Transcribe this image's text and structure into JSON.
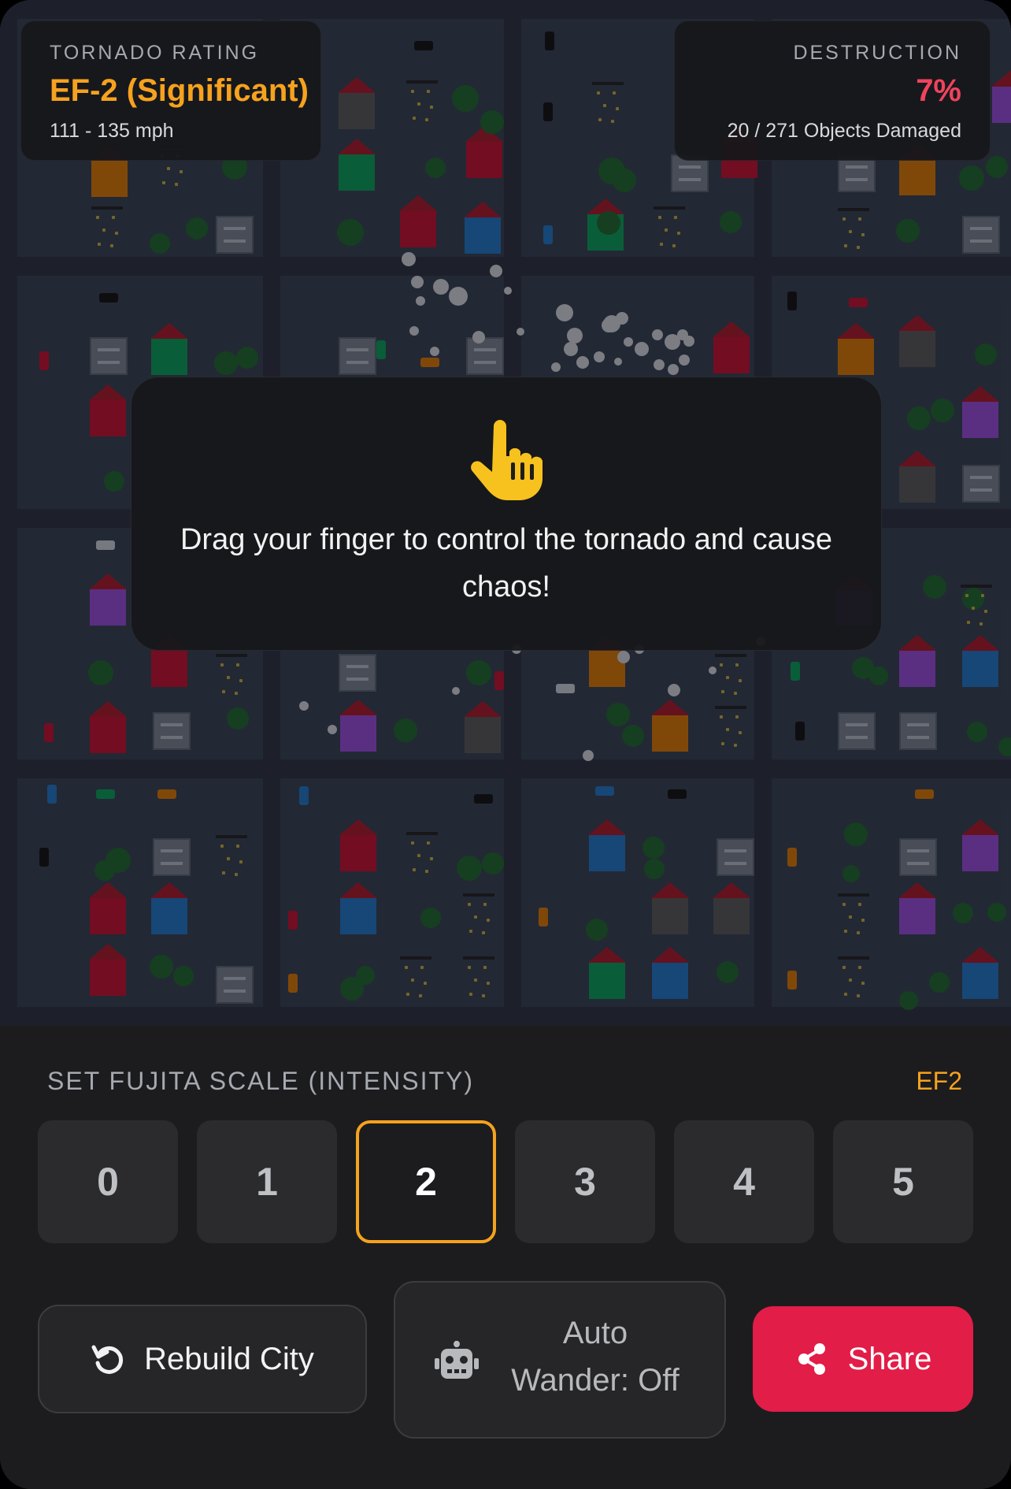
{
  "hud": {
    "rating_caption": "TORNADO RATING",
    "rating_value": "EF-2 (Significant)",
    "rating_speed": "111 - 135 mph",
    "destruction_caption": "DESTRUCTION",
    "destruction_percent": "7%",
    "objects_damaged": "20 / 271 Objects Damaged"
  },
  "overlay": {
    "icon": "pointing-hand-icon",
    "message": "Drag your finger to control the tornado and cause chaos!"
  },
  "scale": {
    "label": "SET FUJITA SCALE (INTENSITY)",
    "current": "EF2",
    "options": [
      "0",
      "1",
      "2",
      "3",
      "4",
      "5"
    ],
    "selected": "2"
  },
  "actions": {
    "rebuild_label": "Rebuild City",
    "auto_wander_label_1": "Auto",
    "auto_wander_label_2": "Wander: Off",
    "share_label": "Share"
  },
  "colors": {
    "accent_orange": "#f6a21e",
    "destruction_red": "#f0435d",
    "share_red": "#e11d48",
    "panel_bg": "#1c1c1e"
  }
}
